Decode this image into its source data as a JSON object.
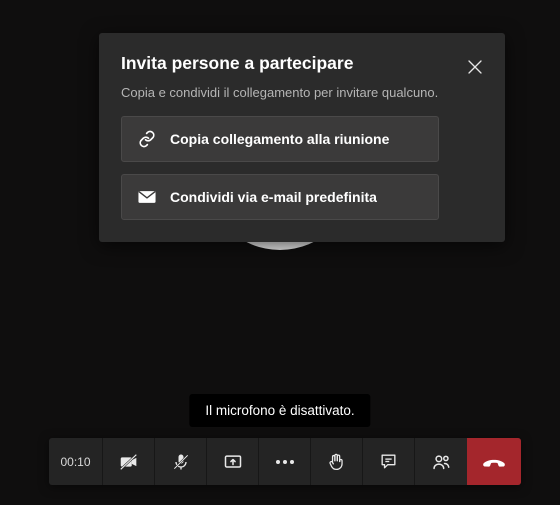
{
  "invite": {
    "title": "Invita persone a partecipare",
    "subtitle": "Copia e condividi il collegamento per invitare qualcuno.",
    "copy_link_label": "Copia collegamento alla riunione",
    "share_email_label": "Condividi via e-mail predefinita"
  },
  "toast": {
    "mic_off": "Il microfono è disattivato."
  },
  "bar": {
    "timer": "00:10"
  },
  "colors": {
    "dialog_bg": "#2b2b2b",
    "button_bg": "#3b3a3a",
    "bar_bg": "#242424",
    "hangup": "#a4262c"
  }
}
